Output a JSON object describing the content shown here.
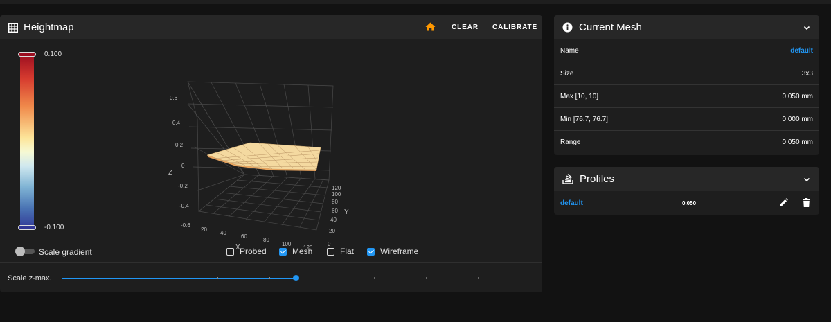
{
  "heightmap": {
    "title": "Heightmap",
    "icon": "grid-icon",
    "home_icon": "home-icon",
    "clear_label": "CLEAR",
    "calibrate_label": "CALIBRATE",
    "legend": {
      "max": "0.100",
      "min": "-0.100"
    },
    "colors": {
      "accent": "#2196f3",
      "home": "#ff9800"
    },
    "scale_gradient_label": "Scale gradient",
    "scale_gradient_on": false,
    "checkboxes": [
      {
        "label": "Probed",
        "checked": false
      },
      {
        "label": "Mesh",
        "checked": true
      },
      {
        "label": "Flat",
        "checked": false
      },
      {
        "label": "Wireframe",
        "checked": true
      }
    ],
    "scale_zmax_label": "Scale z-max.",
    "scale_zmax_value": 0.5,
    "plot": {
      "z_ticks": [
        "0.6",
        "0.4",
        "0.2",
        "0",
        "-0.2",
        "-0.4",
        "-0.6"
      ],
      "x_ticks": [
        "20",
        "40",
        "60",
        "80",
        "100",
        "120"
      ],
      "y_ticks": [
        "120",
        "100",
        "80",
        "60",
        "40",
        "20",
        "0"
      ],
      "x_label": "X",
      "y_label": "Y",
      "z_label": "Z"
    }
  },
  "current_mesh": {
    "title": "Current Mesh",
    "icon": "info-icon",
    "rows": [
      {
        "label": "Name",
        "value": "default"
      },
      {
        "label": "Size",
        "value": "3x3"
      },
      {
        "label": "Max [10, 10]",
        "value": "0.050 mm"
      },
      {
        "label": "Min [76.7, 76.7]",
        "value": "0.000 mm"
      },
      {
        "label": "Range",
        "value": "0.050 mm"
      }
    ]
  },
  "profiles": {
    "title": "Profiles",
    "icon": "layers-icon",
    "items": [
      {
        "name": "default",
        "value": "0.050"
      }
    ]
  }
}
